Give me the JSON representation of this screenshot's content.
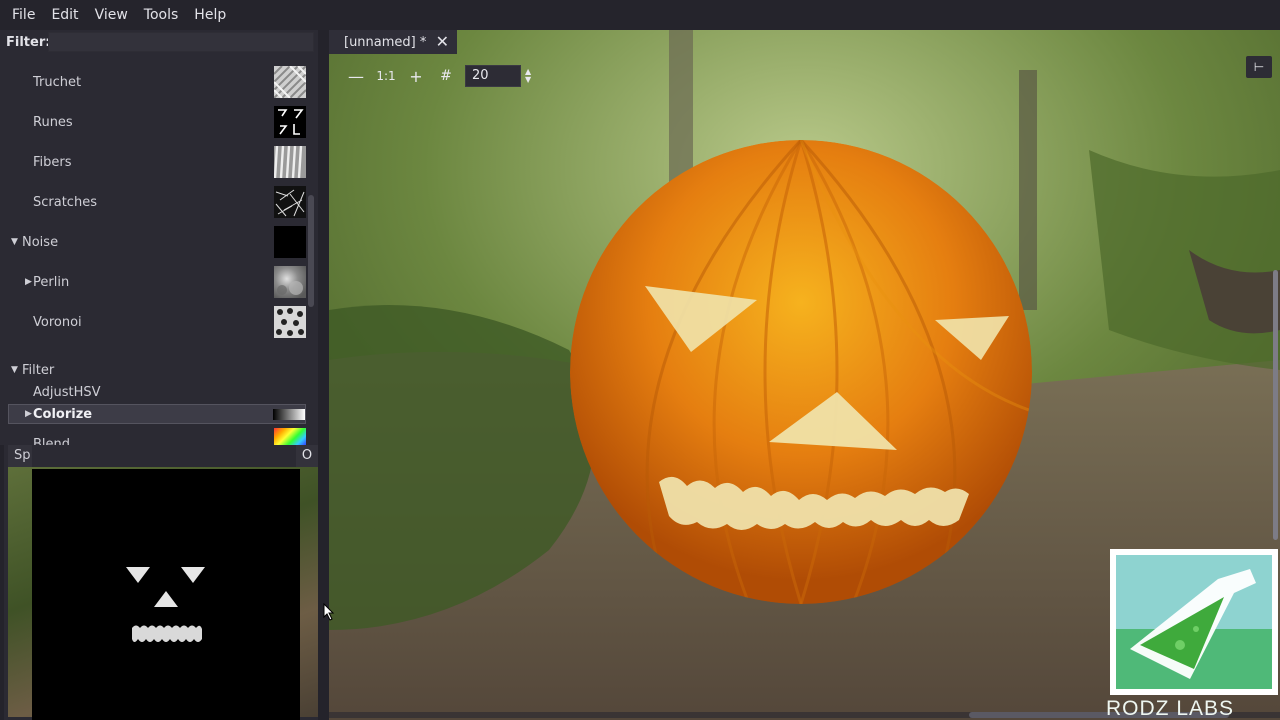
{
  "menu": [
    "File",
    "Edit",
    "View",
    "Tools",
    "Help"
  ],
  "filter": {
    "label": "Filter:",
    "value": ""
  },
  "library": {
    "items": [
      {
        "label": "Truchet",
        "indent": 2,
        "arrow": "",
        "thumb": "truchet"
      },
      {
        "label": "Runes",
        "indent": 2,
        "arrow": "",
        "thumb": "runes"
      },
      {
        "label": "Fibers",
        "indent": 2,
        "arrow": "",
        "thumb": "fibers"
      },
      {
        "label": "Scratches",
        "indent": 2,
        "arrow": "",
        "thumb": "scratches"
      },
      {
        "label": "Noise",
        "indent": 1,
        "arrow": "down",
        "thumb": "black"
      },
      {
        "label": "Perlin",
        "indent": 2,
        "arrow": "right",
        "thumb": "perlin"
      },
      {
        "label": "Voronoi",
        "indent": 2,
        "arrow": "",
        "thumb": "voronoi"
      },
      {
        "label": "Filter",
        "indent": 1,
        "arrow": "down",
        "thumb": ""
      },
      {
        "label": "AdjustHSV",
        "indent": 2,
        "arrow": "",
        "thumb": ""
      },
      {
        "label": "Colorize",
        "indent": 2,
        "arrow": "right",
        "thumb": "gradient",
        "selected": true
      },
      {
        "label": "Blend",
        "indent": 2,
        "arrow": "",
        "thumb": "rainbow"
      }
    ]
  },
  "preview": {
    "tab_label": "Sp",
    "tab_right": "O"
  },
  "document": {
    "tab_title": "[unnamed] *"
  },
  "viewport_toolbar": {
    "zoom_value": "20"
  },
  "watermark": {
    "text": "RODZ LABS"
  },
  "colors": {
    "panel": "#2b2a33",
    "accent_green": "#3cb371",
    "pumpkin": "#e07a10"
  }
}
